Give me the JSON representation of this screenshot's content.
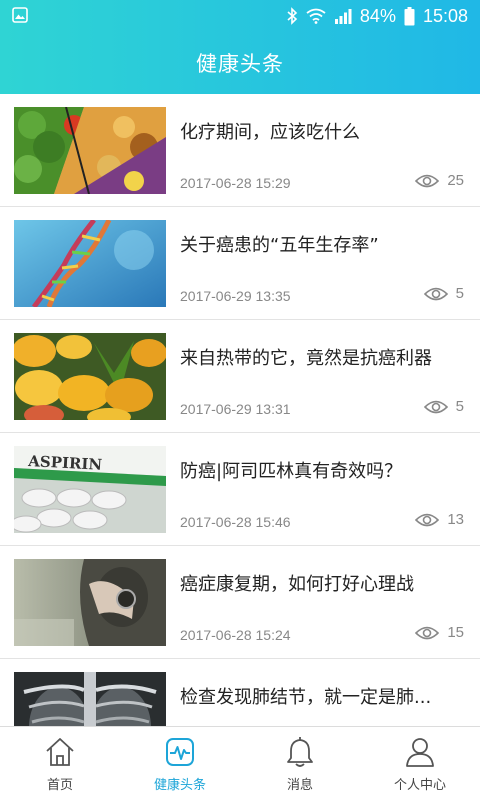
{
  "status_bar": {
    "battery_pct": "84%",
    "time": "15:08"
  },
  "header": {
    "title": "健康头条"
  },
  "articles": [
    {
      "title": "化疗期间，应该吃什么",
      "date": "2017-06-28 15:29",
      "views": "25",
      "thumb": "vegetables-image"
    },
    {
      "title": "关于癌患的“五年生存率”",
      "date": "2017-06-29 13:35",
      "views": "5",
      "thumb": "dna-image"
    },
    {
      "title": "来自热带的它，竟然是抗癌利器",
      "date": "2017-06-29 13:31",
      "views": "5",
      "thumb": "mango-image"
    },
    {
      "title": "防癌|阿司匹林真有奇效吗？",
      "date": "2017-06-28 15:46",
      "views": "13",
      "thumb": "aspirin-image",
      "thumb_text": "ASPIRIN"
    },
    {
      "title": "癌症康复期，如何打好心理战",
      "date": "2017-06-28 15:24",
      "views": "15",
      "thumb": "woman-image"
    },
    {
      "title": "检查发现肺结节，就一定是肺...",
      "date": "",
      "views": "",
      "thumb": "xray-image"
    }
  ],
  "tabbar": {
    "tabs": [
      {
        "label": "首页",
        "icon": "home-icon"
      },
      {
        "label": "健康头条",
        "icon": "health-icon",
        "active": true
      },
      {
        "label": "消息",
        "icon": "bell-icon"
      },
      {
        "label": "个人中心",
        "icon": "person-icon"
      }
    ]
  },
  "colors": {
    "accent": "#1da5d8",
    "header_start": "#2fd4d4",
    "header_end": "#20b8e6"
  }
}
